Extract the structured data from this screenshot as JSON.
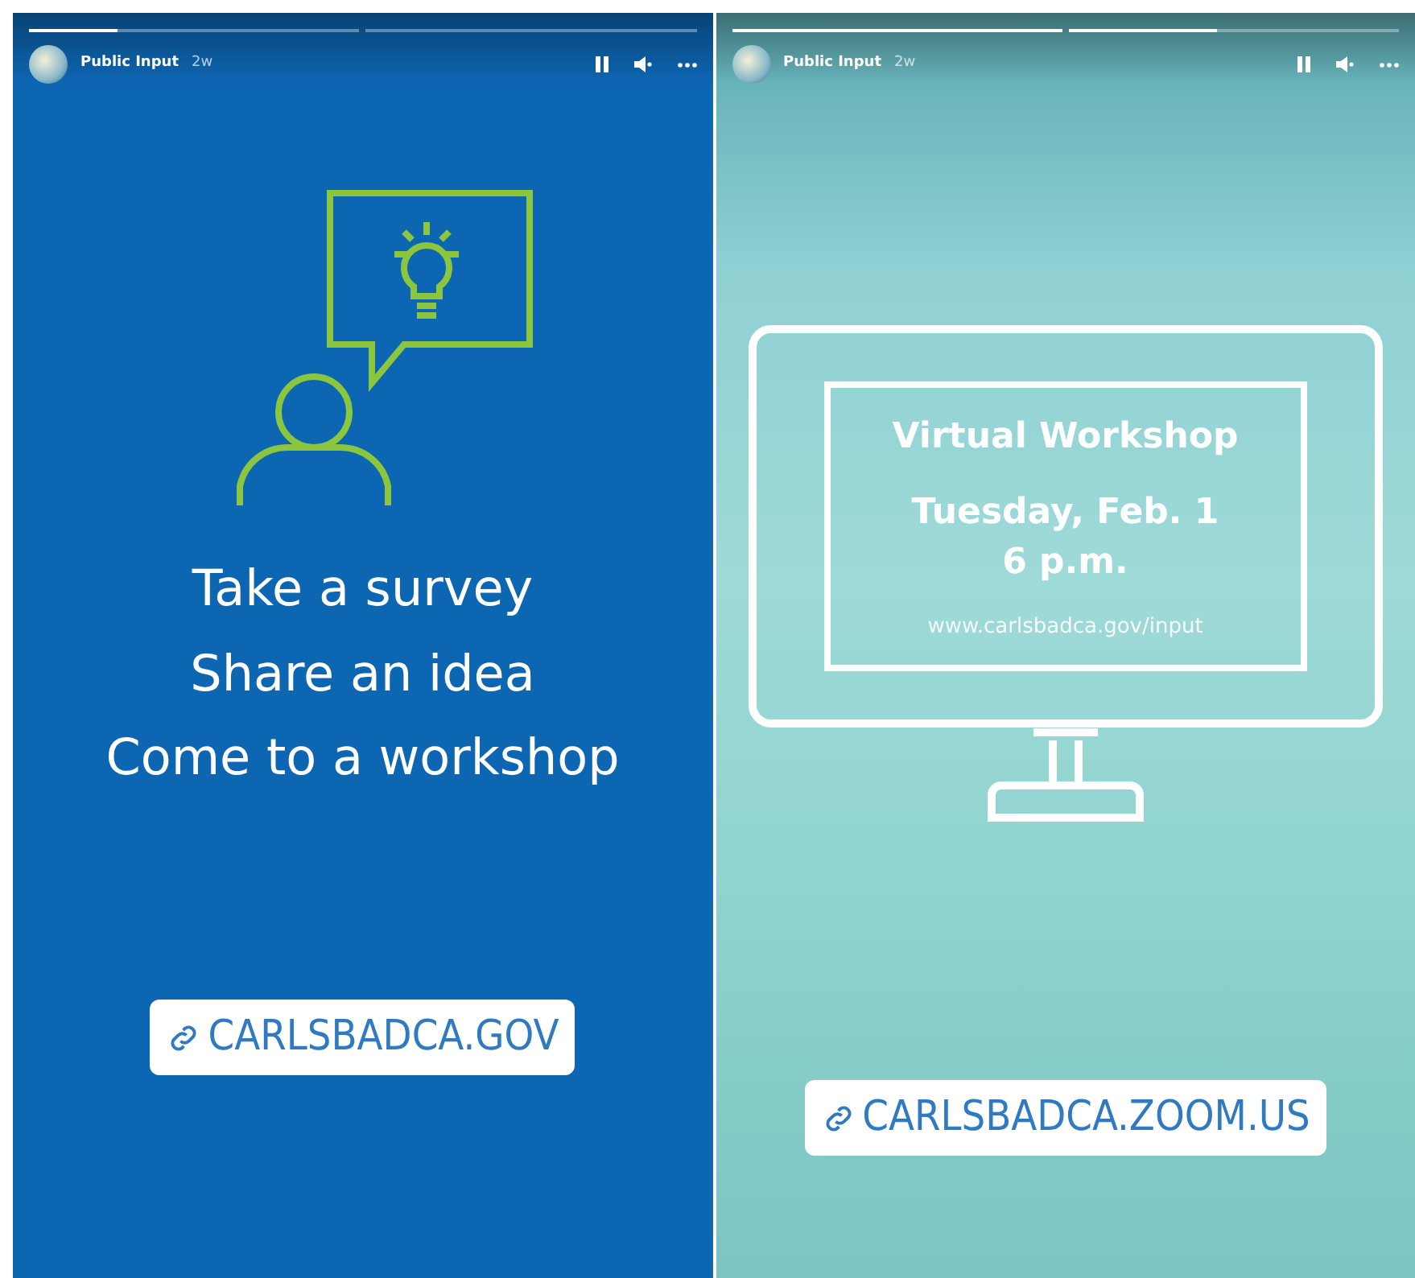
{
  "stories": [
    {
      "kind": "survey",
      "account": "Public Input",
      "age": "2w",
      "progress": [
        {
          "level": 0.27
        },
        {
          "level": 0
        }
      ],
      "lines": [
        "Take a survey",
        "Share an idea",
        "Come to a workshop"
      ],
      "link": "CARLSBADCA.GOV"
    },
    {
      "kind": "workshop",
      "account": "Public Input",
      "age": "2w",
      "progress": [
        {
          "level": 1
        },
        {
          "level": 0.45
        }
      ],
      "screen_title": "Virtual Workshop",
      "screen_date": "Tuesday, Feb. 1",
      "screen_time": "6 p.m.",
      "screen_url": "www.carlsbadca.gov/input",
      "link": "CARLSBADCA.ZOOM.US"
    }
  ]
}
